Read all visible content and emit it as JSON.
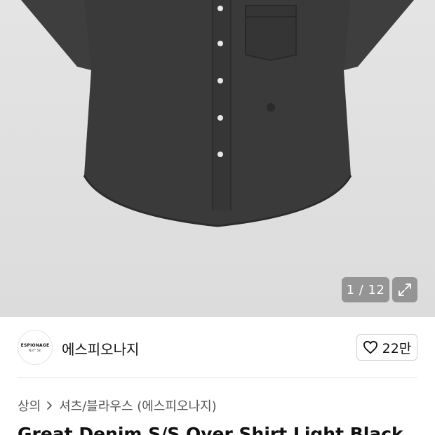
{
  "gallery": {
    "counter": "1 / 12",
    "background": "#e0e0e0",
    "product_color": "#3a3a3a"
  },
  "brand": {
    "logo_line1": "ESPIONAGE",
    "logo_line2": "N37° 58'",
    "name": "에스피오나지",
    "likes": "22만"
  },
  "breadcrumb": {
    "level1": "상의",
    "level2": "셔츠/블라우스 (에스피오나지)"
  },
  "product": {
    "title": "Great Denim S/S Over Shirt Light Black"
  }
}
